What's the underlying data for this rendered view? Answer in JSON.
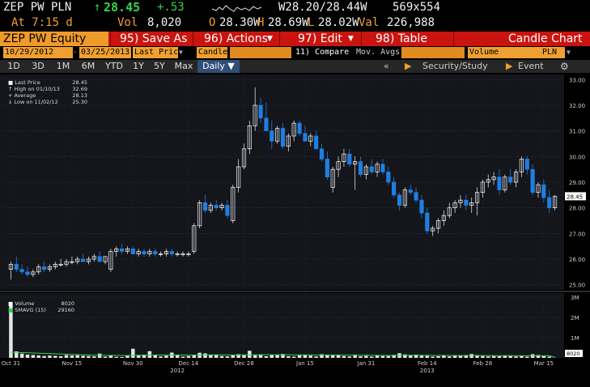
{
  "header": {
    "ticker": "ZEP PW PLN",
    "arrow": "↑",
    "price": "28.45",
    "change": "+.53",
    "bid_ask": "W28.20/28.44W",
    "size": "569x554",
    "time": "At 7:15 d",
    "volume_label": "Vol",
    "volume": "8,020",
    "open_label": "O",
    "open": "28.30W",
    "high_label": "H",
    "high": "28.69W",
    "low_label": "L",
    "low": "28.02W",
    "val_label": "Val",
    "val": "226,988"
  },
  "toolbar": {
    "security": "ZEP PW Equity",
    "save_as": "95) Save As",
    "actions": "96) Actions",
    "edit": "97) Edit",
    "table": "98) Table",
    "chart_title": "Candle Chart"
  },
  "options": {
    "start_date": "10/29/2012",
    "end_date": "03/25/2013",
    "price_field": "Last Price",
    "chart_type": "Candle",
    "compare": "11) Compare",
    "mov_avgs": "Mov. Avgs",
    "volume_field": "Volume",
    "currency": "PLN"
  },
  "periods": [
    {
      "label": "1D",
      "selected": false
    },
    {
      "label": "3D",
      "selected": false
    },
    {
      "label": "1M",
      "selected": false
    },
    {
      "label": "6M",
      "selected": false
    },
    {
      "label": "YTD",
      "selected": false
    },
    {
      "label": "1Y",
      "selected": false
    },
    {
      "label": "5Y",
      "selected": false
    },
    {
      "label": "Max",
      "selected": false
    },
    {
      "label": "Daily ▼",
      "selected": true
    }
  ],
  "side_panel": {
    "collapse": "«",
    "security_study": "Security/Study",
    "event": "Event",
    "settings_icon": "gear-icon"
  },
  "price_legend": {
    "last_price_label": "Last Price",
    "last_price": "28.45",
    "high_label": "High on 01/10/13",
    "high": "32.69",
    "average_label": "Average",
    "average": "28.13",
    "low_label": "Low on 11/02/12",
    "low": "25.30"
  },
  "volume_legend": {
    "volume_label": "Volume",
    "volume": "8020",
    "smavg_label": "SMAVG (15)",
    "smavg": "29160"
  },
  "colors": {
    "up": "#ffffff",
    "down": "#1f7fe0",
    "smavg": "#2fd64a",
    "background": "#14161c",
    "price_tag": "#ffffff"
  },
  "chart_data": {
    "type": "candlestick",
    "price_axis": {
      "ticks": [
        "25.00",
        "26.00",
        "27.00",
        "28.00",
        "29.00",
        "30.00",
        "31.00",
        "32.00",
        "33.00"
      ],
      "ylim": [
        24.8,
        33.2
      ]
    },
    "volume_axis": {
      "ticks": [
        "1M",
        "2M",
        "3M"
      ],
      "ylim": [
        0,
        3200000
      ]
    },
    "last_price_tag": "28.45",
    "last_volume_tag": "8020",
    "x_ticks": [
      "Oct 31",
      "Nov 15",
      "Nov 30",
      "Dec 14",
      "Dec 28",
      "Jan 15",
      "Jan 31",
      "Feb 14",
      "Feb 28",
      "Mar 15"
    ],
    "x_years": [
      "2012",
      "2013"
    ],
    "ohlc": [
      [
        25.6,
        25.9,
        25.2,
        25.8
      ],
      [
        25.8,
        26.1,
        25.5,
        25.6
      ],
      [
        25.6,
        25.8,
        25.4,
        25.5
      ],
      [
        25.5,
        25.7,
        25.3,
        25.4
      ],
      [
        25.4,
        25.6,
        25.3,
        25.5
      ],
      [
        25.5,
        25.8,
        25.4,
        25.7
      ],
      [
        25.7,
        25.9,
        25.5,
        25.6
      ],
      [
        25.6,
        25.8,
        25.5,
        25.7
      ],
      [
        25.7,
        25.9,
        25.6,
        25.8
      ],
      [
        25.8,
        26.0,
        25.7,
        25.8
      ],
      [
        25.8,
        26.0,
        25.7,
        25.9
      ],
      [
        25.9,
        26.1,
        25.8,
        25.9
      ],
      [
        25.9,
        26.1,
        25.8,
        26.0
      ],
      [
        26.0,
        26.2,
        25.9,
        25.9
      ],
      [
        25.9,
        26.1,
        25.8,
        26.0
      ],
      [
        26.0,
        26.2,
        25.9,
        26.1
      ],
      [
        26.1,
        26.3,
        25.9,
        25.9
      ],
      [
        25.9,
        26.1,
        25.8,
        26.1
      ],
      [
        25.6,
        26.4,
        25.5,
        26.3
      ],
      [
        26.3,
        26.5,
        26.1,
        26.4
      ],
      [
        26.4,
        26.6,
        26.2,
        26.3
      ],
      [
        26.3,
        26.5,
        26.2,
        26.4
      ],
      [
        26.4,
        26.5,
        26.2,
        26.2
      ],
      [
        26.2,
        26.4,
        26.1,
        26.3
      ],
      [
        26.3,
        26.4,
        26.1,
        26.2
      ],
      [
        26.2,
        26.4,
        26.1,
        26.3
      ],
      [
        26.3,
        26.4,
        26.1,
        26.2
      ],
      [
        26.2,
        26.3,
        26.1,
        26.2
      ],
      [
        26.2,
        26.4,
        26.1,
        26.3
      ],
      [
        26.3,
        26.4,
        26.1,
        26.2
      ],
      [
        26.2,
        26.3,
        26.1,
        26.2
      ],
      [
        26.2,
        26.3,
        26.1,
        26.2
      ],
      [
        26.2,
        26.3,
        26.1,
        26.2
      ],
      [
        26.3,
        27.4,
        26.2,
        27.3
      ],
      [
        27.3,
        28.3,
        27.2,
        28.2
      ],
      [
        28.2,
        28.5,
        27.8,
        27.9
      ],
      [
        27.9,
        28.2,
        27.8,
        28.1
      ],
      [
        28.1,
        28.3,
        27.9,
        28.0
      ],
      [
        28.0,
        28.2,
        27.9,
        28.1
      ],
      [
        28.1,
        28.3,
        27.6,
        27.7
      ],
      [
        27.5,
        28.9,
        27.4,
        28.8
      ],
      [
        28.8,
        29.9,
        28.6,
        29.6
      ],
      [
        29.6,
        30.5,
        29.5,
        30.3
      ],
      [
        30.3,
        31.4,
        30.1,
        31.2
      ],
      [
        31.2,
        32.7,
        31.0,
        32.0
      ],
      [
        32.0,
        32.3,
        31.3,
        31.5
      ],
      [
        31.5,
        32.1,
        31.0,
        31.0
      ],
      [
        31.0,
        31.4,
        30.3,
        30.6
      ],
      [
        30.6,
        31.2,
        30.5,
        31.1
      ],
      [
        31.1,
        31.3,
        30.3,
        30.4
      ],
      [
        30.4,
        30.9,
        30.2,
        30.8
      ],
      [
        30.8,
        31.4,
        30.6,
        31.3
      ],
      [
        31.3,
        31.4,
        30.8,
        30.9
      ],
      [
        30.9,
        31.2,
        30.6,
        30.6
      ],
      [
        30.6,
        30.9,
        30.4,
        30.8
      ],
      [
        30.8,
        31.0,
        30.3,
        30.3
      ],
      [
        30.3,
        30.5,
        29.8,
        29.9
      ],
      [
        29.9,
        30.2,
        29.1,
        29.2
      ],
      [
        28.8,
        29.6,
        28.6,
        29.5
      ],
      [
        29.5,
        30.0,
        29.2,
        29.8
      ],
      [
        29.8,
        30.3,
        29.6,
        30.1
      ],
      [
        30.1,
        30.3,
        29.6,
        29.7
      ],
      [
        29.7,
        30.0,
        28.7,
        29.8
      ],
      [
        29.8,
        30.0,
        29.2,
        29.3
      ],
      [
        29.3,
        29.7,
        29.1,
        29.6
      ],
      [
        29.6,
        29.9,
        29.3,
        29.4
      ],
      [
        29.4,
        29.8,
        29.2,
        29.7
      ],
      [
        29.7,
        29.9,
        29.3,
        29.4
      ],
      [
        29.4,
        29.6,
        28.9,
        29.0
      ],
      [
        29.0,
        29.2,
        28.4,
        28.5
      ],
      [
        28.5,
        28.6,
        27.9,
        28.1
      ],
      [
        28.1,
        28.8,
        28.0,
        28.7
      ],
      [
        28.7,
        28.9,
        28.5,
        28.6
      ],
      [
        28.6,
        28.8,
        28.2,
        28.3
      ],
      [
        28.3,
        28.5,
        27.6,
        27.8
      ],
      [
        27.8,
        28.0,
        27.0,
        27.1
      ],
      [
        27.1,
        27.3,
        26.9,
        27.2
      ],
      [
        27.2,
        27.6,
        27.0,
        27.5
      ],
      [
        27.5,
        27.9,
        27.3,
        27.7
      ],
      [
        27.7,
        28.2,
        27.6,
        28.0
      ],
      [
        28.0,
        28.3,
        27.8,
        28.2
      ],
      [
        28.2,
        28.5,
        28.0,
        28.3
      ],
      [
        28.3,
        28.5,
        27.9,
        28.1
      ],
      [
        28.1,
        28.4,
        27.8,
        28.2
      ],
      [
        28.2,
        28.8,
        27.7,
        28.6
      ],
      [
        28.6,
        29.1,
        28.4,
        29.0
      ],
      [
        29.0,
        29.3,
        28.8,
        29.1
      ],
      [
        29.1,
        29.4,
        28.9,
        29.2
      ],
      [
        29.2,
        29.5,
        28.5,
        28.7
      ],
      [
        28.7,
        29.3,
        28.6,
        29.2
      ],
      [
        29.2,
        29.5,
        28.9,
        29.0
      ],
      [
        29.0,
        29.5,
        28.8,
        29.4
      ],
      [
        29.4,
        30.0,
        29.2,
        29.9
      ],
      [
        29.9,
        30.0,
        29.3,
        29.5
      ],
      [
        29.5,
        29.7,
        28.5,
        28.6
      ],
      [
        28.6,
        29.0,
        28.4,
        28.9
      ],
      [
        28.9,
        29.1,
        28.2,
        28.4
      ],
      [
        28.4,
        28.7,
        27.8,
        28.0
      ],
      [
        28.0,
        28.5,
        27.9,
        28.45
      ]
    ],
    "volumes": [
      2650000,
      320000,
      210000,
      160000,
      140000,
      120000,
      90000,
      110000,
      95000,
      80000,
      140000,
      120000,
      130000,
      100000,
      90000,
      75000,
      210000,
      60000,
      110000,
      50000,
      40000,
      120000,
      450000,
      140000,
      160000,
      330000,
      150000,
      70000,
      110000,
      260000,
      120000,
      60000,
      90000,
      150000,
      250000,
      220000,
      140000,
      160000,
      90000,
      75000,
      120000,
      180000,
      160000,
      350000,
      130000,
      150000,
      80000,
      160000,
      140000,
      190000,
      80000,
      60000,
      130000,
      160000,
      110000,
      70000,
      180000,
      150000,
      130000,
      120000,
      90000,
      70000,
      160000,
      80000,
      100000,
      60000,
      140000,
      90000,
      90000,
      150000,
      230000,
      170000,
      120000,
      160000,
      110000,
      100000,
      60000,
      80000,
      130000,
      70000,
      110000,
      120000,
      140000,
      190000,
      100000,
      90000,
      70000,
      90000,
      80000,
      110000,
      90000,
      70000,
      80000,
      60000,
      180000,
      140000,
      90000,
      60000,
      8020
    ],
    "smavg": [
      280000,
      270000,
      260000,
      250000,
      240000,
      230000,
      220000,
      210000,
      200000,
      190000,
      180000,
      170000,
      160000,
      150000,
      140000,
      135000,
      130000,
      125000,
      120000,
      118000,
      115000,
      115000,
      125000,
      128000,
      130000,
      140000,
      140000,
      138000,
      135000,
      140000,
      140000,
      138000,
      135000,
      136000,
      140000,
      145000,
      146000,
      148000,
      146000,
      143000,
      140000,
      142000,
      143000,
      150000,
      152000,
      155000,
      153000,
      152000,
      150000,
      152000,
      150000,
      146000,
      143000,
      145000,
      143000,
      140000,
      142000,
      141000,
      140000,
      138000,
      136000,
      133000,
      133000,
      130000,
      128000,
      125000,
      124000,
      122000,
      120000,
      122000,
      125000,
      127000,
      128000,
      129000,
      127000,
      124000,
      120000,
      118000,
      118000,
      116000,
      115000,
      115000,
      116000,
      118000,
      118000,
      116000,
      113000,
      112000,
      110000,
      110000,
      109000,
      107000,
      106000,
      104000,
      106000,
      107000,
      106000,
      104000,
      29160
    ]
  }
}
